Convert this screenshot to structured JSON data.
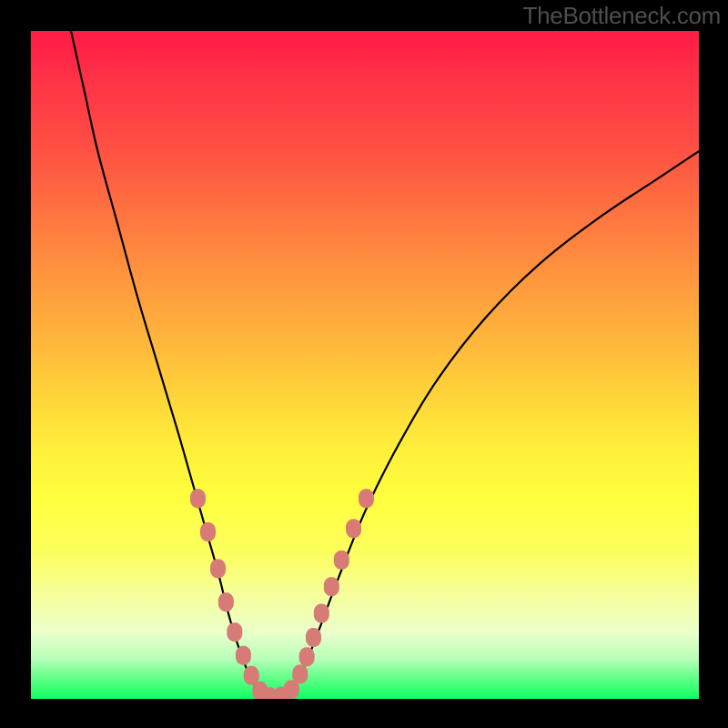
{
  "watermark": "TheBottleneck.com",
  "chart_data": {
    "type": "line",
    "title": "",
    "xlabel": "",
    "ylabel": "",
    "xlim": [
      0,
      100
    ],
    "ylim": [
      0,
      100
    ],
    "series": [
      {
        "name": "left-branch",
        "x": [
          6,
          8,
          10,
          13,
          16,
          19,
          22,
          24,
          26,
          28,
          29.5,
          31,
          32.5,
          34
        ],
        "y": [
          100,
          91,
          82,
          71,
          60,
          50,
          40,
          33,
          26,
          19,
          13,
          8,
          4,
          1
        ]
      },
      {
        "name": "valley",
        "x": [
          34,
          35.5,
          37,
          39
        ],
        "y": [
          1,
          0.3,
          0.3,
          1
        ]
      },
      {
        "name": "right-branch",
        "x": [
          39,
          41,
          43,
          46,
          50,
          55,
          61,
          68,
          76,
          85,
          94,
          100
        ],
        "y": [
          1,
          5,
          10,
          18,
          28,
          38,
          48,
          57,
          65,
          72,
          78,
          82
        ]
      }
    ],
    "markers": [
      {
        "x": 25.0,
        "y": 30.0
      },
      {
        "x": 26.5,
        "y": 25.0
      },
      {
        "x": 28.0,
        "y": 19.5
      },
      {
        "x": 29.2,
        "y": 14.5
      },
      {
        "x": 30.5,
        "y": 10.0
      },
      {
        "x": 31.8,
        "y": 6.5
      },
      {
        "x": 33.0,
        "y": 3.5
      },
      {
        "x": 34.3,
        "y": 1.2
      },
      {
        "x": 35.8,
        "y": 0.3
      },
      {
        "x": 37.5,
        "y": 0.4
      },
      {
        "x": 39.0,
        "y": 1.4
      },
      {
        "x": 40.3,
        "y": 3.7
      },
      {
        "x": 41.3,
        "y": 6.3
      },
      {
        "x": 42.3,
        "y": 9.2
      },
      {
        "x": 43.5,
        "y": 12.8
      },
      {
        "x": 45.0,
        "y": 16.8
      },
      {
        "x": 46.5,
        "y": 20.8
      },
      {
        "x": 48.3,
        "y": 25.5
      },
      {
        "x": 50.2,
        "y": 30.0
      }
    ],
    "marker_color": "#d77b77",
    "curve_color": "#000000",
    "gradient_stops": [
      {
        "pos": 0,
        "color": "#ff1b46"
      },
      {
        "pos": 50,
        "color": "#ffd93a"
      },
      {
        "pos": 80,
        "color": "#f6ff98"
      },
      {
        "pos": 100,
        "color": "#0dff62"
      }
    ]
  }
}
